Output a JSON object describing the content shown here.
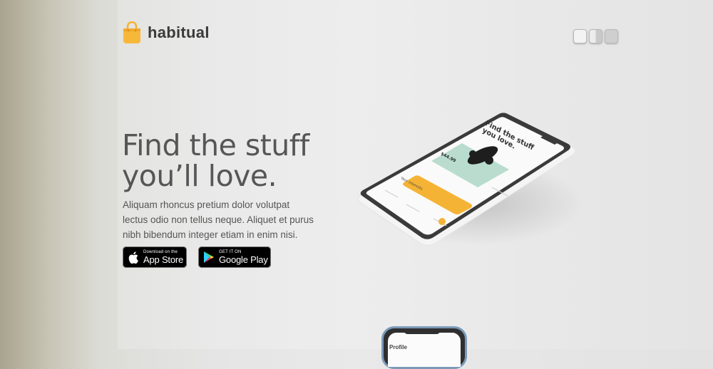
{
  "brand": {
    "name": "habitual",
    "accent": "#f5b335"
  },
  "theme_switcher": {
    "options": [
      "light-theme",
      "split-theme",
      "dark-theme"
    ]
  },
  "hero": {
    "title_line1": "Find the stuff",
    "title_line2": "you’ll love.",
    "body_lines": [
      "Aliquam rhoncus pretium dolor volutpat",
      "lectus odio non tellus neque. Aliquet et purus",
      "nibh bibendum integer etiam in enim nisi."
    ]
  },
  "store_buttons": {
    "apple": {
      "small": "Download on the",
      "big": "App Store",
      "icon": "apple-icon"
    },
    "google": {
      "small": "GET IT ON",
      "big": "Google Play",
      "icon": "google-play-icon"
    }
  },
  "phone_mockup": {
    "headline_line1": "Find the stuff",
    "headline_line2": "you love.",
    "price": "$44.99",
    "section_label": "Your interests",
    "product_icon": "game-controller-icon",
    "cta_color": "#f5b335"
  },
  "phone_peek": {
    "label": "Profile"
  }
}
